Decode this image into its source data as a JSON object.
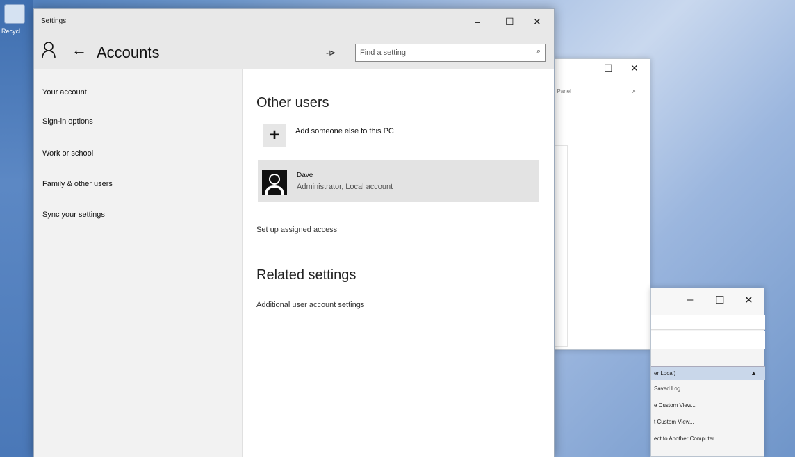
{
  "desktop": {
    "recycle_label": "Recycl"
  },
  "settings_window": {
    "title": "Settings",
    "controls": {
      "minimize": "–",
      "maximize": "☐",
      "close": "✕"
    },
    "header": {
      "back_icon": "←",
      "page_title": "Accounts",
      "pin_icon": "-⊳",
      "search_placeholder": "Find a setting",
      "search_icon": "⌕"
    },
    "sidebar": {
      "items": [
        {
          "label": "Your account"
        },
        {
          "label": "Sign-in options"
        },
        {
          "label": "Work or school"
        },
        {
          "label": "Family & other users"
        },
        {
          "label": "Sync your settings"
        }
      ]
    },
    "main": {
      "other_users_title": "Other users",
      "add_icon": "+",
      "add_label": "Add someone else to this PC",
      "user": {
        "name": "Dave",
        "detail": "Administrator, Local account"
      },
      "assigned_access_link": "Set up assigned access",
      "related_title": "Related settings",
      "related_link": "Additional user account settings"
    }
  },
  "background_window": {
    "controls": {
      "minimize": "–",
      "maximize": "☐",
      "close": "✕"
    },
    "search_text": "ol Panel",
    "search_icon": "⌕"
  },
  "event_window": {
    "controls": {
      "minimize": "–",
      "maximize": "☐",
      "close": "✕"
    },
    "header_label": "er Local)",
    "header_icon": "▲",
    "items": [
      "Saved Log...",
      "e Custom View...",
      "t Custom View...",
      "ect to Another Computer..."
    ]
  }
}
